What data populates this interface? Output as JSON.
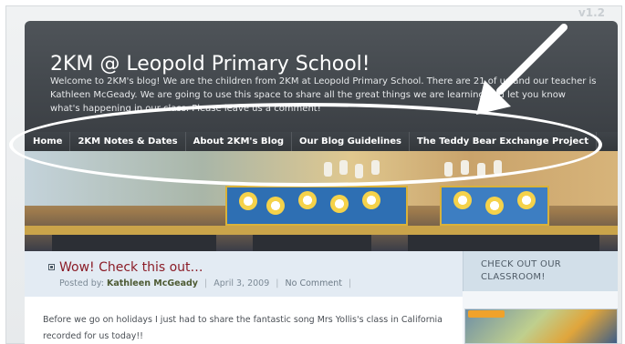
{
  "version_label": "v1.2",
  "header": {
    "title": "2KM @ Leopold Primary School!",
    "description": "Welcome to 2KM's blog! We are the children from 2KM at Leopold Primary School. There are 21 of us and our teacher is Kathleen McGeady. We are going to use this space to share all the great things we are learning and let you know what's happening in our class. Please leave us a comment!"
  },
  "nav": {
    "items": [
      {
        "label": "Home"
      },
      {
        "label": "2KM Notes & Dates"
      },
      {
        "label": "About 2KM's Blog"
      },
      {
        "label": "Our Blog Guidelines"
      },
      {
        "label": "The Teddy Bear Exchange Project"
      }
    ]
  },
  "post": {
    "title": "Wow! Check this out…",
    "posted_by_label": "Posted by:",
    "author": "Kathleen McGeady",
    "date": "April 3, 2009",
    "comments": "No Comment",
    "body": "Before we go on holidays I just had to share the fantastic song Mrs Yollis's class in California recorded for us today!!"
  },
  "sidebar": {
    "heading": "Check out our classroom!"
  },
  "colors": {
    "header_bg": "#44494e",
    "nav_bg": "#3a3e43",
    "post_title": "#8b1c27",
    "author": "#4d5a33",
    "sidebar_bg": "#d2dfe9"
  },
  "annotations": {
    "ellipse_color": "#ffffff",
    "arrow_color": "#ffffff"
  }
}
